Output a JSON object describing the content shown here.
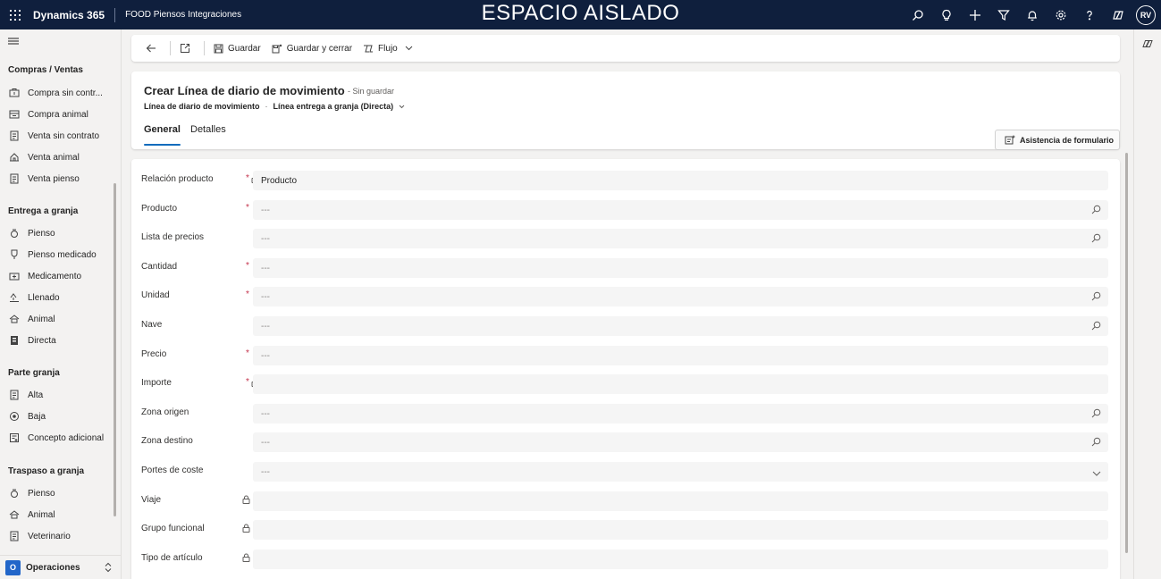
{
  "topbar": {
    "app_name": "Dynamics 365",
    "environment": "FOOD Piensos Integraciones",
    "sandbox_banner": "ESPACIO AISLADO",
    "user_initials": "RV",
    "icons": [
      "search-icon",
      "lightbulb-icon",
      "plus-icon",
      "filter-icon",
      "bell-icon",
      "gear-icon",
      "help-icon",
      "copilot-icon"
    ]
  },
  "sidebar": {
    "groups": [
      {
        "title": "Compras / Ventas",
        "items": [
          "Compra sin contr...",
          "Compra animal",
          "Venta sin contrato",
          "Venta animal",
          "Venta pienso"
        ]
      },
      {
        "title": "Entrega a granja",
        "items": [
          "Pienso",
          "Pienso medicado",
          "Medicamento",
          "Llenado",
          "Animal",
          "Directa"
        ]
      },
      {
        "title": "Parte granja",
        "items": [
          "Alta",
          "Baja",
          "Concepto adicional"
        ]
      },
      {
        "title": "Traspaso a granja",
        "items": [
          "Pienso",
          "Animal",
          "Veterinario"
        ]
      }
    ],
    "area": {
      "badge": "O",
      "label": "Operaciones"
    }
  },
  "commandbar": {
    "save_label": "Guardar",
    "save_close_label": "Guardar y cerrar",
    "flow_label": "Flujo"
  },
  "header": {
    "title": "Crear Línea de diario de movimiento",
    "status": "- Sin guardar",
    "entity": "Línea de diario de movimiento",
    "form_selector": "Línea entrega a granja (Directa)",
    "tabs": [
      "General",
      "Detalles"
    ],
    "assist_label": "Asistencia de formulario"
  },
  "form": {
    "empty_placeholder": "---",
    "fields": [
      {
        "label": "Relación producto",
        "required": true,
        "locked": true,
        "value": "Producto",
        "icon": ""
      },
      {
        "label": "Producto",
        "required": true,
        "locked": false,
        "value": "---",
        "icon": "search"
      },
      {
        "label": "Lista de precios",
        "required": false,
        "locked": false,
        "value": "---",
        "icon": "search"
      },
      {
        "label": "Cantidad",
        "required": true,
        "locked": false,
        "value": "---",
        "icon": ""
      },
      {
        "label": "Unidad",
        "required": true,
        "locked": false,
        "value": "---",
        "icon": "search"
      },
      {
        "label": "Nave",
        "required": false,
        "locked": false,
        "value": "---",
        "icon": "search"
      },
      {
        "label": "Precio",
        "required": true,
        "locked": false,
        "value": "---",
        "icon": ""
      },
      {
        "label": "Importe",
        "required": true,
        "locked": true,
        "value": "",
        "icon": ""
      },
      {
        "label": "Zona origen",
        "required": false,
        "locked": false,
        "value": "---",
        "icon": "search"
      },
      {
        "label": "Zona destino",
        "required": false,
        "locked": false,
        "value": "---",
        "icon": "search"
      },
      {
        "label": "Portes de coste",
        "required": false,
        "locked": false,
        "value": "---",
        "icon": "chevron"
      },
      {
        "label": "Viaje",
        "required": false,
        "locked": true,
        "value": "",
        "icon": ""
      },
      {
        "label": "Grupo funcional",
        "required": false,
        "locked": true,
        "value": "",
        "icon": ""
      },
      {
        "label": "Tipo de artículo",
        "required": false,
        "locked": true,
        "value": "",
        "icon": ""
      }
    ]
  },
  "colors": {
    "topbar": "#0f1f3d",
    "accent": "#0f6cbd",
    "required": "#c4314b",
    "area_badge": "#2266c9"
  }
}
